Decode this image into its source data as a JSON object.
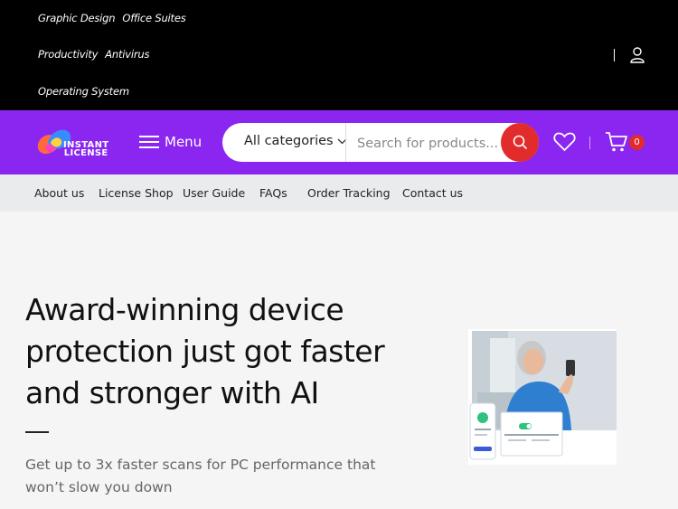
{
  "topbar": {
    "links_row1": [
      "Graphic Design",
      "Office Suites"
    ],
    "links_row2": [
      "Productivity",
      "Antivirus"
    ],
    "links_row3": [
      "Operating System"
    ]
  },
  "header": {
    "logo_line1": "INSTANT",
    "logo_line2": "LICENSE",
    "menu_label": "Menu",
    "category_label": "All categories",
    "search_placeholder": "Search for products...",
    "cart_count": "0",
    "accent_color": "#8a26f0",
    "search_button_color": "#e22b2b"
  },
  "nav": {
    "items": [
      "About us",
      "License Shop",
      "User Guide",
      "FAQs",
      "Order Tracking",
      "Contact us"
    ]
  },
  "hero": {
    "title": "Award-winning device protection just got faster and stronger with AI",
    "subtitle": "Get up to 3x faster scans for PC performance that won’t slow you down"
  },
  "icons": [
    "user-icon",
    "menu-icon",
    "chevron-down-icon",
    "search-icon",
    "heart-icon",
    "cart-icon"
  ]
}
